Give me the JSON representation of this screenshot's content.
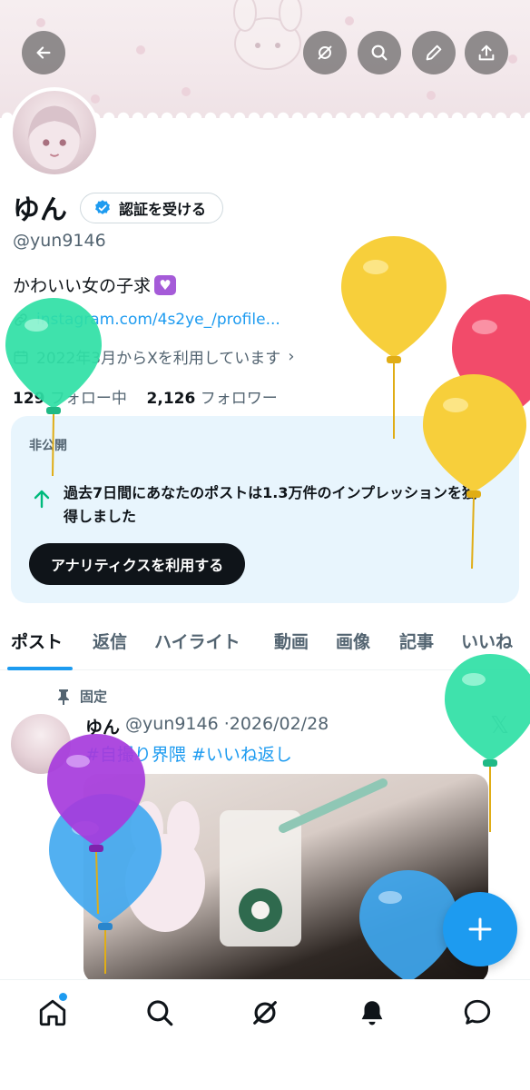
{
  "profile": {
    "name": "ゆん",
    "verify_label": "認証を受ける",
    "handle": "@yun9146",
    "bio": "かわいい女の子求",
    "link": "instagram.com/4s2ye_/profile...",
    "joined": "2022年3月からXを利用しています",
    "following_count": "129",
    "following_label": "フォロー中",
    "followers_count": "2,126",
    "followers_label": "フォロワー"
  },
  "insight_card": {
    "private_label": "非公開",
    "message": "過去7日間にあなたのポストは1.3万件のインプレッションを獲得しました",
    "button_label": "アナリティクスを利用する"
  },
  "tabs": [
    {
      "label": "ポスト"
    },
    {
      "label": "返信"
    },
    {
      "label": "ハイライト"
    },
    {
      "label": "動画"
    },
    {
      "label": "画像"
    },
    {
      "label": "記事"
    },
    {
      "label": "いいね"
    }
  ],
  "pinned_post": {
    "pinned_label": "固定",
    "name": "ゆん",
    "handle": "@yun9146",
    "date": "·2026/02/28",
    "tags": "#自撮り界隈 #いいね返し"
  },
  "colors": {
    "accent": "#1d9bf0",
    "card_bg": "#e8f5fd",
    "text": "#0f1419",
    "muted": "#536471"
  },
  "icons": {
    "back": "arrow-left-icon",
    "grok": "grok-icon",
    "search": "search-icon",
    "edit": "pencil-icon",
    "share": "share-icon",
    "home": "home-icon",
    "notifications": "bell-icon",
    "messages": "chat-bubble-icon",
    "compose": "plus-icon"
  }
}
